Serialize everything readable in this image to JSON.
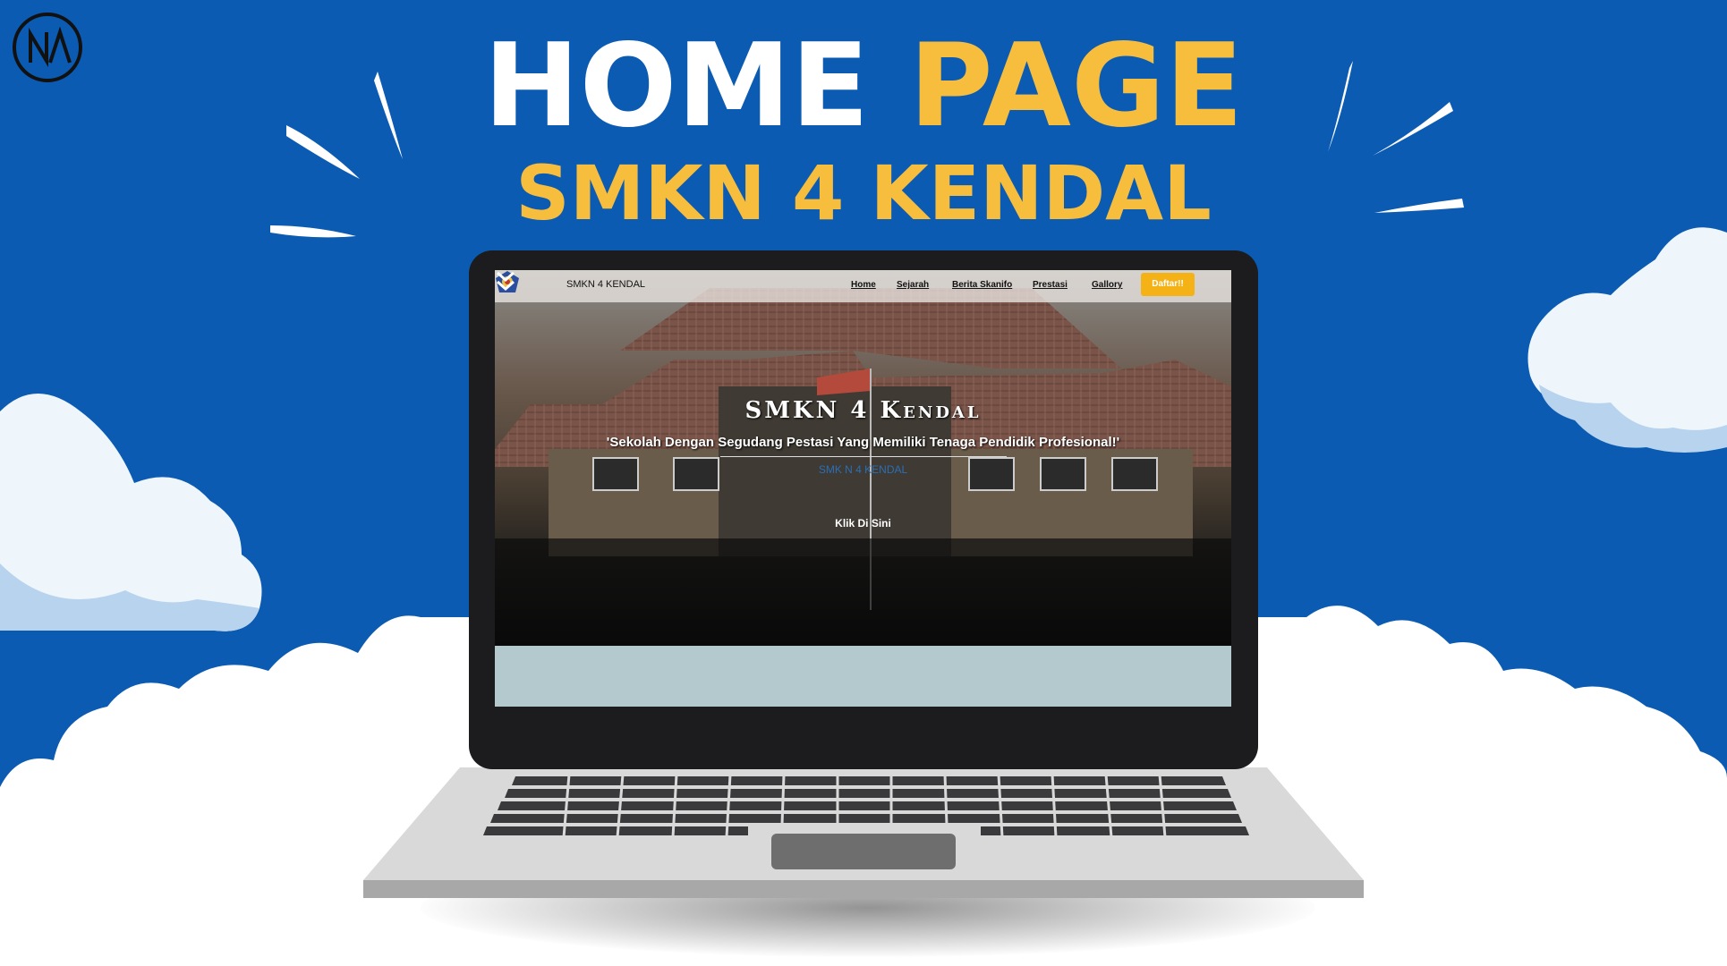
{
  "heading": {
    "line1_word1": "HOME",
    "line1_word2": "PAGE",
    "line2": "SMKN 4 KENDAL"
  },
  "logo": {
    "icon": "na-monogram-icon"
  },
  "colors": {
    "background": "#0b5bb3",
    "accent_yellow": "#f7bd3d",
    "cta_orange": "#f5b216",
    "laptop_bezel": "#1c1c1e",
    "laptop_body": "#d9d9d9",
    "keys": "#3a3a3c"
  },
  "website": {
    "brand": "SMKN 4 KENDAL",
    "brand_icon": "school-emblem-icon",
    "nav": [
      {
        "label": "Home"
      },
      {
        "label": "Sejarah"
      },
      {
        "label": "Berita Skanifo"
      },
      {
        "label": "Prestasi"
      },
      {
        "label": "Gallory"
      }
    ],
    "cta": "Daftar!!",
    "hero": {
      "title": "SMKN 4 Kendal",
      "tagline": "'Sekolah Dengan Segudang Pestasi Yang Memiliki Tenaga Pendidik Profesional!'",
      "sub": "SMK N 4 KENDAL",
      "button": "Klik Di Sini",
      "button_icon": "double-chevron-down-icon"
    }
  }
}
